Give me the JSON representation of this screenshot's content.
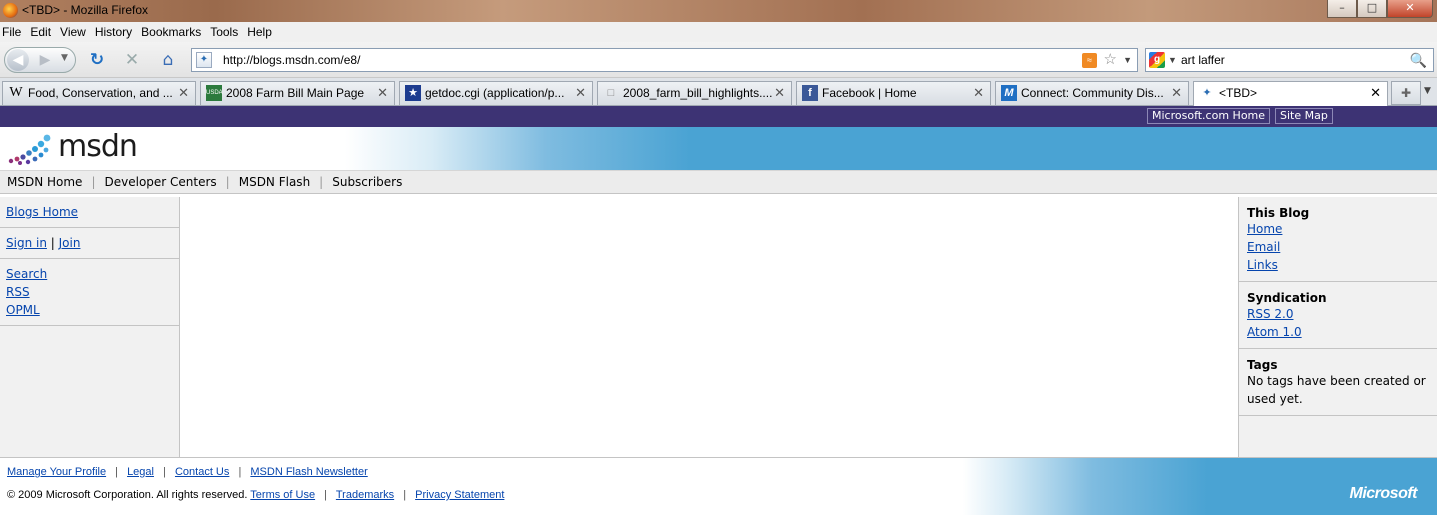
{
  "window": {
    "title": "<TBD> - Mozilla Firefox",
    "minimize": "–",
    "maximize": "□",
    "close": "✕"
  },
  "menu": [
    "File",
    "Edit",
    "View",
    "History",
    "Bookmarks",
    "Tools",
    "Help"
  ],
  "toolbar": {
    "url": "http://blogs.msdn.com/e8/",
    "search_query": "art laffer"
  },
  "tabs": [
    {
      "label": "Food, Conservation, and ...",
      "icon": "W"
    },
    {
      "label": "2008 Farm Bill Main Page",
      "icon": "USDA"
    },
    {
      "label": "getdoc.cgi (application/p...",
      "icon": "★"
    },
    {
      "label": "2008_farm_bill_highlights....",
      "icon": "□"
    },
    {
      "label": "Facebook | Home",
      "icon": "f"
    },
    {
      "label": "Connect: Community Dis...",
      "icon": "M"
    },
    {
      "label": "<TBD>",
      "icon": "msdn"
    }
  ],
  "header": {
    "microsoft_home": "Microsoft.com Home",
    "site_map": "Site Map",
    "logo_text": "msdn",
    "nav": [
      "MSDN Home",
      "Developer Centers",
      "MSDN Flash",
      "Subscribers"
    ]
  },
  "left": {
    "blogs_home": "Blogs Home",
    "sign_in": "Sign in",
    "join": "Join",
    "links": [
      "Search",
      "RSS",
      "OPML"
    ]
  },
  "right": {
    "this_blog_title": "This Blog",
    "this_blog_links": [
      "Home",
      "Email",
      "Links"
    ],
    "syndication_title": "Syndication",
    "syndication_links": [
      "RSS 2.0",
      "Atom 1.0"
    ],
    "tags_title": "Tags",
    "tags_text": "No tags have been created or used yet."
  },
  "footer": {
    "row1": [
      "Manage Your Profile",
      "Legal",
      "Contact Us",
      "MSDN Flash Newsletter"
    ],
    "copyright": "© 2009 Microsoft Corporation. All rights reserved.",
    "row2": [
      "Terms of Use",
      "Trademarks",
      "Privacy Statement"
    ],
    "brand": "Microsoft"
  },
  "colors": {
    "header_purple": "#3d3374",
    "brand_blue": "#4aa3d3",
    "link": "#0645ad"
  }
}
